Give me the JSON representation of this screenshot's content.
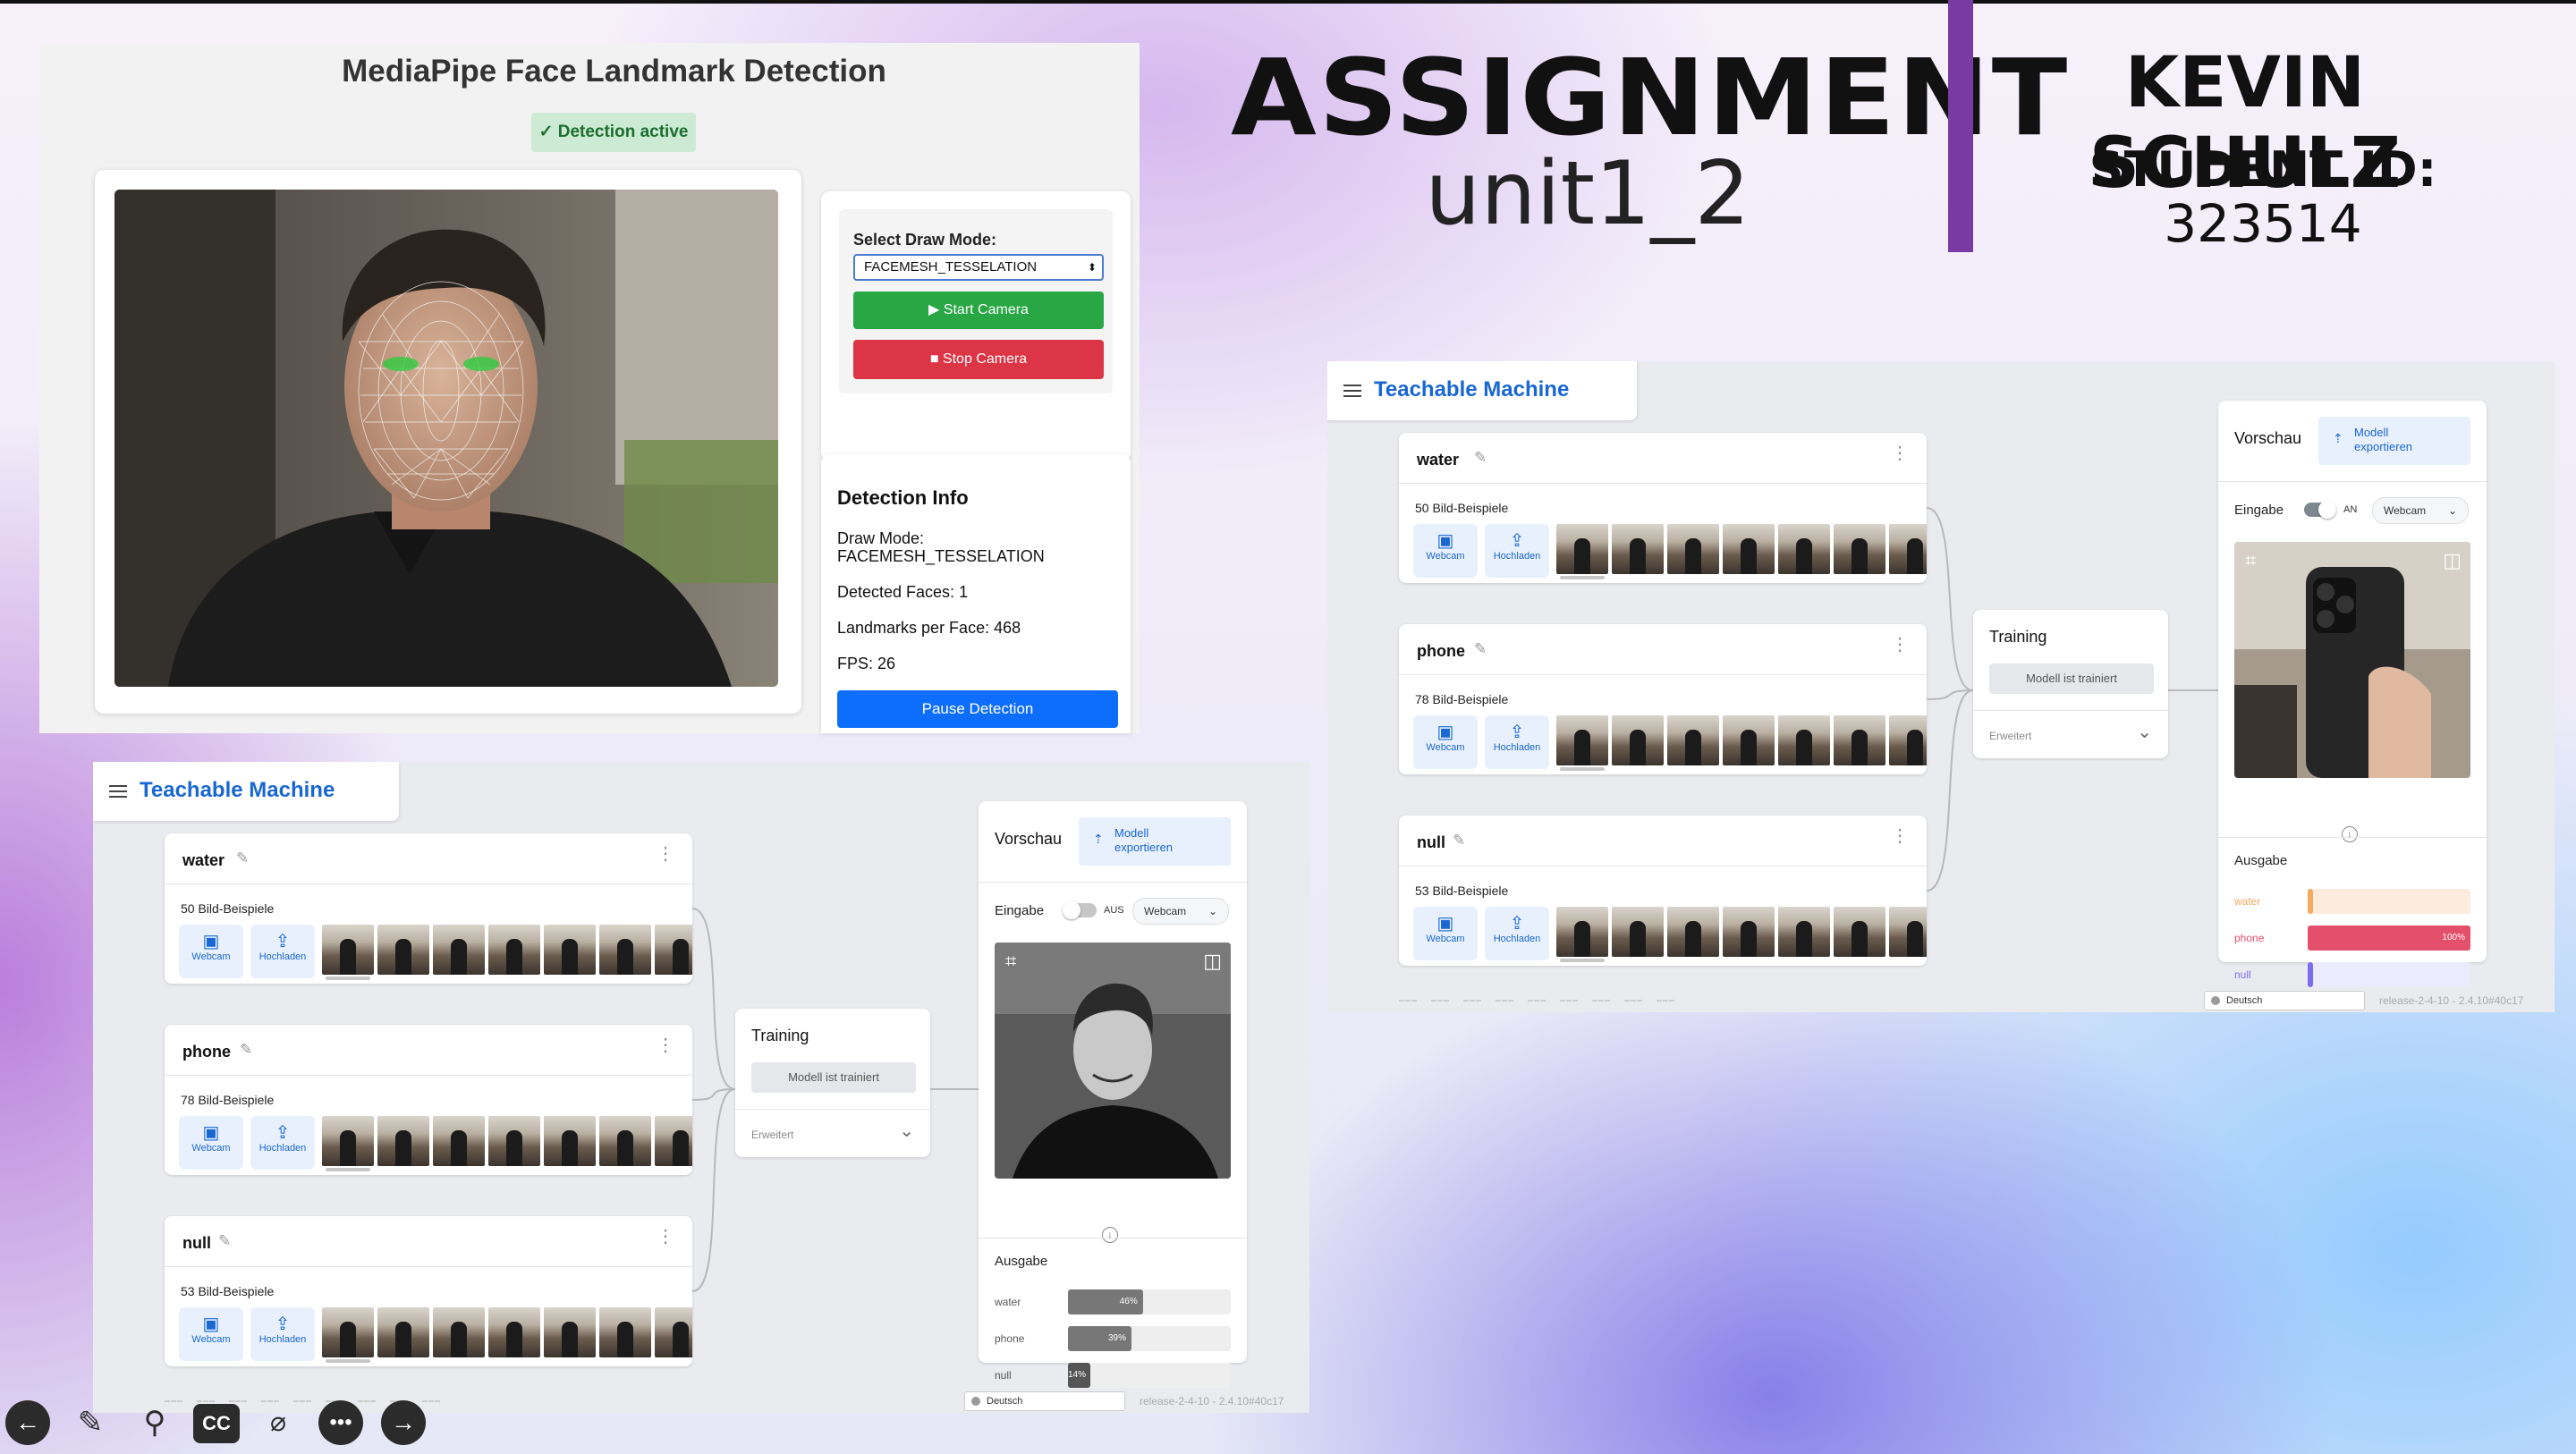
{
  "slide": {
    "title": "ASSIGNMENT",
    "subtitle": "unit1_2",
    "author": "KEVIN SCHULZ",
    "student_id_label": "STUDENT ID:",
    "student_id": "323514",
    "accent_color": "#7a3aa3"
  },
  "mediapipe": {
    "title": "MediaPipe Face Landmark Detection",
    "status_badge": "✓ Detection active",
    "draw_mode_label": "Select Draw Mode:",
    "draw_mode_value": "FACEMESH_TESSELATION",
    "start_button": "▶ Start Camera",
    "stop_button": "■ Stop Camera",
    "info_title": "Detection Info",
    "info_draw_mode_label": "Draw Mode:",
    "info_draw_mode_value": "FACEMESH_TESSELATION",
    "info_faces": "Detected Faces: 1",
    "info_landmarks": "Landmarks per Face: 468",
    "info_fps": "FPS: 26",
    "pause_button": "Pause Detection"
  },
  "tm_left": {
    "app_title": "Teachable Machine",
    "classes": [
      {
        "name": "water",
        "count": "50 Bild-Beispiele"
      },
      {
        "name": "phone",
        "count": "78 Bild-Beispiele"
      },
      {
        "name": "null",
        "count": "53 Bild-Beispiele"
      }
    ],
    "webcam_label": "Webcam",
    "upload_label": "Hochladen",
    "training_title": "Training",
    "training_button": "Modell ist trainiert",
    "advanced_label": "Erweitert",
    "preview_title": "Vorschau",
    "export_label_1": "Modell",
    "export_label_2": "exportieren",
    "input_label": "Eingabe",
    "toggle_state": "AUS",
    "source_select": "Webcam",
    "output_label": "Ausgabe",
    "outputs": [
      {
        "label": "water",
        "value": 46,
        "text": "46%",
        "color": "#777777"
      },
      {
        "label": "phone",
        "value": 39,
        "text": "39%",
        "color": "#777777"
      },
      {
        "label": "null",
        "value": 14,
        "text": "14%",
        "color": "#555555"
      }
    ],
    "language": "Deutsch",
    "release": "release-2-4-10 - 2.4.10#40c17"
  },
  "tm_right": {
    "app_title": "Teachable Machine",
    "classes": [
      {
        "name": "water",
        "count": "50 Bild-Beispiele"
      },
      {
        "name": "phone",
        "count": "78 Bild-Beispiele"
      },
      {
        "name": "null",
        "count": "53 Bild-Beispiele"
      }
    ],
    "webcam_label": "Webcam",
    "upload_label": "Hochladen",
    "training_title": "Training",
    "training_button": "Modell ist trainiert",
    "advanced_label": "Erweitert",
    "preview_title": "Vorschau",
    "export_label_1": "Modell",
    "export_label_2": "exportieren",
    "input_label": "Eingabe",
    "toggle_state": "AN",
    "source_select": "Webcam",
    "output_label": "Ausgabe",
    "outputs": [
      {
        "label": "water",
        "value": 0,
        "text": "",
        "color": "#f4a95f",
        "track": "#fdebdd"
      },
      {
        "label": "phone",
        "value": 100,
        "text": "100%",
        "color": "#e4506c",
        "track": "#fbe0e6"
      },
      {
        "label": "null",
        "value": 0,
        "text": "",
        "color": "#7b6cf0",
        "track": "#ecebfd"
      }
    ],
    "language": "Deutsch",
    "release": "release-2-4-10 - 2.4.10#40c17"
  },
  "toolbar": {
    "icons": [
      "back-arrow-icon",
      "pen-icon",
      "zoom-icon",
      "captions-icon",
      "camera-off-icon",
      "more-icon",
      "forward-arrow-icon"
    ]
  }
}
